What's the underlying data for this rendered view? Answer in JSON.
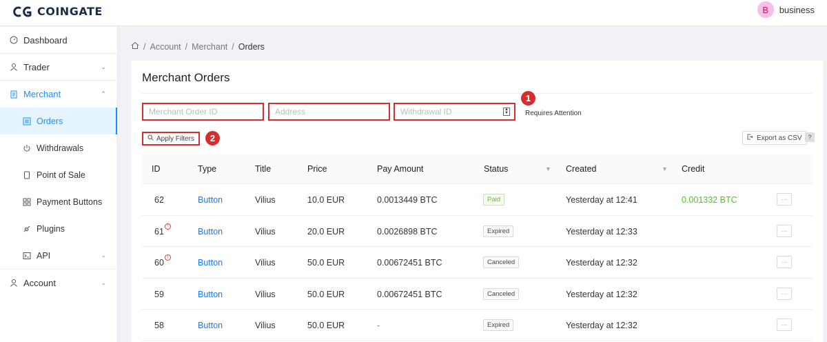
{
  "header": {
    "logo_text": "COINGATE",
    "avatar_letter": "B",
    "username": "business"
  },
  "sidebar": {
    "items": [
      {
        "label": "Dashboard",
        "icon": "gauge-icon"
      },
      {
        "label": "Trader",
        "icon": "user-icon"
      },
      {
        "label": "Merchant",
        "icon": "receipt-icon"
      },
      {
        "label": "Orders",
        "icon": "list-icon"
      },
      {
        "label": "Withdrawals",
        "icon": "power-icon"
      },
      {
        "label": "Point of Sale",
        "icon": "tablet-icon"
      },
      {
        "label": "Payment Buttons",
        "icon": "grid-icon"
      },
      {
        "label": "Plugins",
        "icon": "plug-icon"
      },
      {
        "label": "API",
        "icon": "terminal-icon"
      },
      {
        "label": "Account",
        "icon": "user-icon"
      }
    ]
  },
  "breadcrumb": {
    "items": [
      "Account",
      "Merchant",
      "Orders"
    ]
  },
  "main": {
    "title": "Merchant Orders",
    "filters": {
      "order_id_placeholder": "Merchant Order ID",
      "address_placeholder": "Address",
      "withdrawal_placeholder": "Withdrawal ID",
      "requires_attention": "Requires Attention",
      "apply_label": "Apply Filters",
      "export_label": "Export as CSV",
      "help_label": "?"
    },
    "annotations": [
      "1",
      "2"
    ],
    "table": {
      "columns": [
        "ID",
        "Type",
        "Title",
        "Price",
        "Pay Amount",
        "Status",
        "Created",
        "Credit"
      ],
      "rows": [
        {
          "id": "62",
          "type": "Button",
          "title": "Vilius",
          "price": "10.0 EUR",
          "pay_amount": "0.0013449 BTC",
          "status": "Paid",
          "created": "Yesterday at 12:41",
          "credit": "0.001332 BTC",
          "more": "···"
        },
        {
          "id": "61",
          "type": "Button",
          "title": "Vilius",
          "price": "20.0 EUR",
          "pay_amount": "0.0026898 BTC",
          "status": "Expired",
          "created": "Yesterday at 12:33",
          "credit": "",
          "more": "···"
        },
        {
          "id": "60",
          "type": "Button",
          "title": "Vilius",
          "price": "50.0 EUR",
          "pay_amount": "0.00672451 BTC",
          "status": "Canceled",
          "created": "Yesterday at 12:32",
          "credit": "",
          "more": "···"
        },
        {
          "id": "59",
          "type": "Button",
          "title": "Vilius",
          "price": "50.0 EUR",
          "pay_amount": "0.00672451 BTC",
          "status": "Canceled",
          "created": "Yesterday at 12:32",
          "credit": "",
          "more": "···"
        },
        {
          "id": "58",
          "type": "Button",
          "title": "Vilius",
          "price": "50.0 EUR",
          "pay_amount": "-",
          "status": "Expired",
          "created": "Yesterday at 12:32",
          "credit": "",
          "more": "···"
        }
      ]
    }
  },
  "colors": {
    "accent": "#1890ff",
    "annotation_red": "#d32f2f",
    "paid_green": "#52c41a"
  }
}
